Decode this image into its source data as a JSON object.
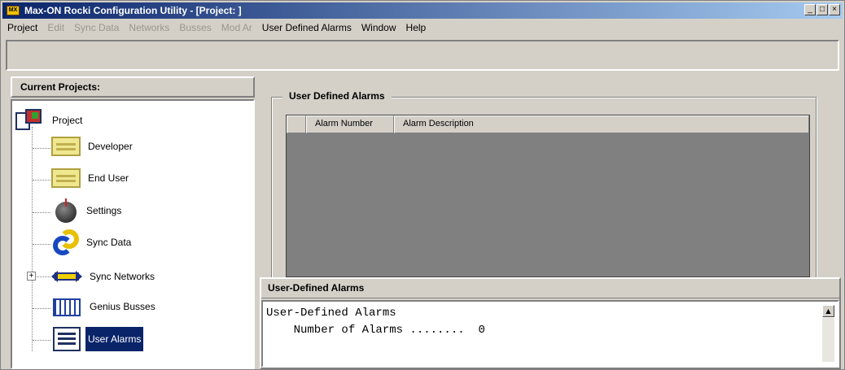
{
  "window": {
    "title": "Max-ON Rocki Configuration Utility - [Project: ]",
    "icon": "app-icon",
    "controls": [
      "minimize",
      "restore",
      "close"
    ]
  },
  "menu": {
    "items": [
      {
        "label": "Project",
        "enabled": true
      },
      {
        "label": "Edit",
        "enabled": false
      },
      {
        "label": "Sync Data",
        "enabled": false
      },
      {
        "label": "Networks",
        "enabled": false
      },
      {
        "label": "Busses",
        "enabled": false
      },
      {
        "label": "Mod Ar",
        "enabled": false
      },
      {
        "label": "User Defined Alarms",
        "enabled": true
      },
      {
        "label": "Window",
        "enabled": true
      },
      {
        "label": "Help",
        "enabled": true
      }
    ]
  },
  "left_pane": {
    "header": "Current Projects:",
    "root": {
      "label": "Project",
      "icon": "project-icon"
    },
    "items": [
      {
        "label": "Developer",
        "icon": "folder-icon"
      },
      {
        "label": "End User",
        "icon": "folder-icon"
      },
      {
        "label": "Settings",
        "icon": "knob-icon"
      },
      {
        "label": "Sync Data",
        "icon": "sync-icon"
      },
      {
        "label": "Sync Networks",
        "icon": "network-icon",
        "expander": "+"
      },
      {
        "label": "Genius Busses",
        "icon": "genius-bus-icon"
      },
      {
        "label": "User Alarms",
        "icon": "alarms-list-icon",
        "selected": true
      }
    ]
  },
  "alarms_group": {
    "title": "User Defined Alarms",
    "columns": [
      "",
      "Alarm Number",
      "Alarm Description"
    ]
  },
  "output": {
    "header": "User-Defined Alarms",
    "line1": "User-Defined Alarms",
    "line2": "    Number of Alarms ........  0"
  },
  "colors": {
    "title_bar_start": "#0a246a",
    "title_bar_end": "#a6caf0",
    "selection": "#0a246a",
    "face": "#d4d0c8",
    "grid_bg": "#808080"
  }
}
